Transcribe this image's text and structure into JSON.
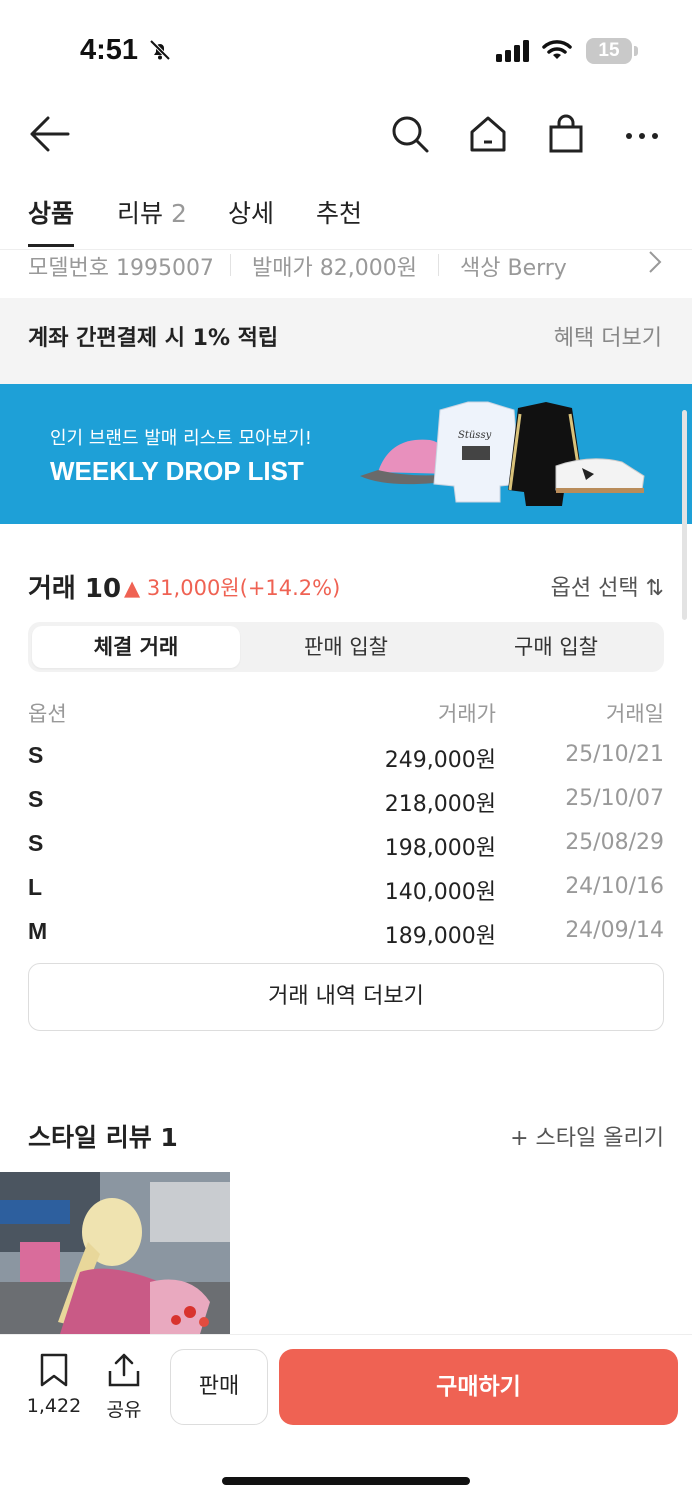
{
  "status": {
    "time": "4:51",
    "battery": "15"
  },
  "tabs": [
    {
      "label": "상품",
      "count": ""
    },
    {
      "label": "리뷰",
      "count": "2"
    },
    {
      "label": "상세",
      "count": ""
    },
    {
      "label": "추천",
      "count": ""
    }
  ],
  "info": {
    "model": "모델번호 1995007",
    "release": "발매가 82,000원",
    "color": "색상 Berry"
  },
  "benefit": {
    "label": "계좌 간편결제 시 1% 적립",
    "link": "혜택 더보기"
  },
  "banner": {
    "subtitle": "인기 브랜드 발매 리스트 모아보기!",
    "title": "WEEKLY DROP LIST"
  },
  "trades": {
    "title": "거래 10",
    "change": "▲ 31,000원(+14.2%)",
    "option_select": "옵션 선택 ⇅",
    "segments": [
      "체결 거래",
      "판매 입찰",
      "구매 입찰"
    ],
    "headers": {
      "option": "옵션",
      "price": "거래가",
      "date": "거래일"
    },
    "rows": [
      {
        "option": "S",
        "price": "249,000원",
        "date": "25/10/21"
      },
      {
        "option": "S",
        "price": "218,000원",
        "date": "25/10/07"
      },
      {
        "option": "S",
        "price": "198,000원",
        "date": "25/08/29"
      },
      {
        "option": "L",
        "price": "140,000원",
        "date": "24/10/16"
      },
      {
        "option": "M",
        "price": "189,000원",
        "date": "24/09/14"
      }
    ],
    "more": "거래 내역 더보기"
  },
  "style_review": {
    "title": "스타일 리뷰 1",
    "add": "+ 스타일 올리기"
  },
  "bottom": {
    "bookmark_count": "1,422",
    "share": "공유",
    "sell": "판매",
    "buy": "구매하기"
  },
  "colors": {
    "accent": "#ef6253",
    "banner": "#1ea0d7"
  }
}
